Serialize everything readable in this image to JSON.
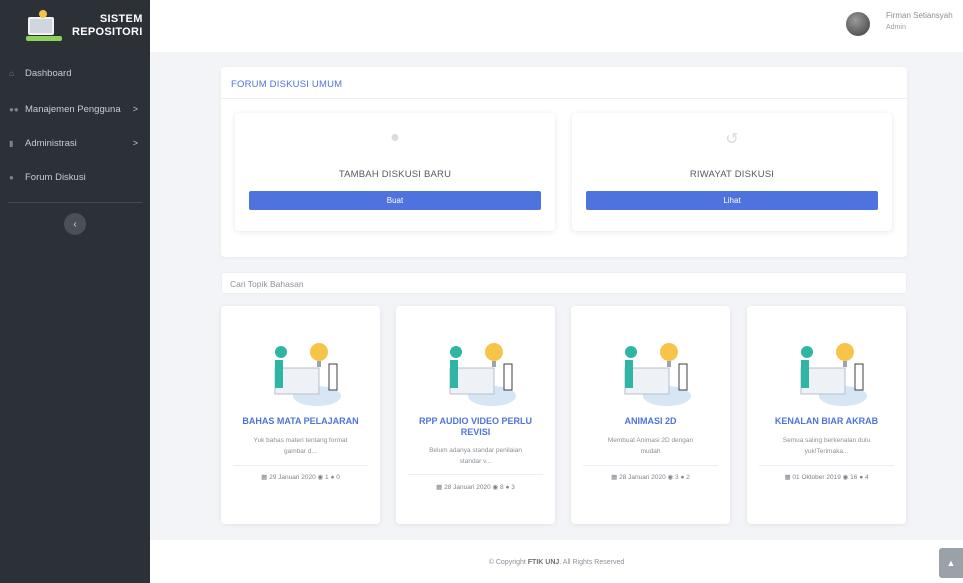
{
  "brand": {
    "line1": "SISTEM",
    "line2": "REPOSITORI"
  },
  "sidebar": {
    "items": [
      {
        "label": "Dashboard",
        "icon": "home-icon",
        "has_chevron": false
      },
      {
        "label": "Manajemen Pengguna",
        "icon": "users-icon",
        "has_chevron": true
      },
      {
        "label": "Administrasi",
        "icon": "file-icon",
        "has_chevron": true
      },
      {
        "label": "Forum Diskusi",
        "icon": "comments-icon",
        "has_chevron": false
      }
    ],
    "chevron": ">",
    "collapse_glyph": "‹"
  },
  "topbar": {
    "user_name": "Firman Setiansyah",
    "user_role": "Admin"
  },
  "forum": {
    "heading": "FORUM DISKUSI UMUM",
    "new_discussion": {
      "icon": "comment-icon",
      "title": "TAMBAH DISKUSI BARU",
      "button": "Buat"
    },
    "history": {
      "icon": "history-icon",
      "title": "RIWAYAT DISKUSI",
      "button": "Lihat"
    }
  },
  "search": {
    "placeholder": "Cari Topik Bahasan"
  },
  "topics": [
    {
      "title": "BAHAS MATA PELAJARAN",
      "desc_line1": "Yuk bahas materi tentang format",
      "desc_line2": "gambar d...",
      "date": "29 Januari 2020",
      "views": "1",
      "comments": "0"
    },
    {
      "title_line1": "RPP AUDIO VIDEO PERLU",
      "title_line2": "REVISI",
      "desc_line1": "Belum adanya standar penilaian",
      "desc_line2": "standar v...",
      "date": "28 Januari 2020",
      "views": "8",
      "comments": "3"
    },
    {
      "title": "ANIMASI 2D",
      "desc_line1": "Membuat Animasi 2D dengan",
      "desc_line2": "mudah",
      "date": "28 Januari 2020",
      "views": "3",
      "comments": "2"
    },
    {
      "title": "KENALAN BIAR AKRAB",
      "desc_line1": "Semua saling berkenalan dulu",
      "desc_line2": "yuk!Terimaka...",
      "date": "01 Oktober 2019",
      "views": "16",
      "comments": "4"
    }
  ],
  "footer": {
    "prefix": "© Copyright ",
    "org": "FTIK UNJ",
    "suffix": ". All Rights Reserved"
  },
  "colors": {
    "accent": "#4e73df",
    "sidebar": "#2c3137"
  }
}
